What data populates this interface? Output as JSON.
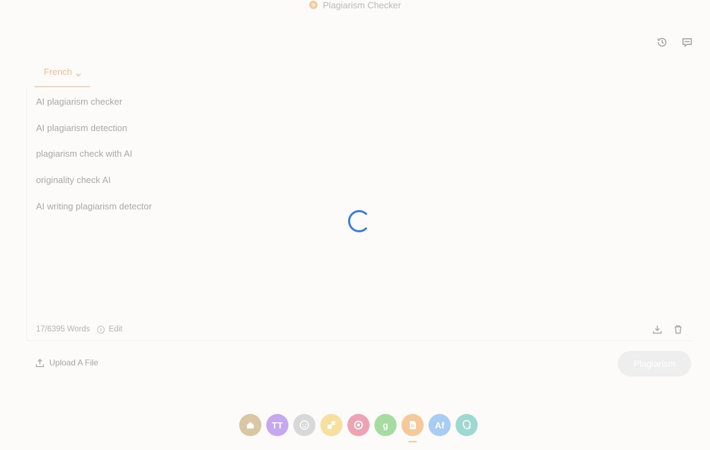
{
  "header": {
    "title": "Plagiarism Checker"
  },
  "top_actions": [
    {
      "name": "history-icon"
    },
    {
      "name": "feedback-chat-icon"
    }
  ],
  "language_tab": {
    "label": "French"
  },
  "keywords": [
    "AI plagiarism checker",
    "AI plagiarism detection",
    "plagiarism check with AI",
    "originality check AI",
    "AI writing plagiarism detector"
  ],
  "editor_footer": {
    "word_count": "17/6395 Words",
    "edit_label": "Edit"
  },
  "upload": {
    "label": "Upload A File"
  },
  "primary_button": {
    "label": "Plagiarism"
  },
  "tools": [
    {
      "name": "tool-home",
      "icon": "house-icon",
      "color": "#d8c7a2"
    },
    {
      "name": "tool-text-size",
      "icon": "tt-icon",
      "color": "#c6a8ef",
      "glyph": "TT"
    },
    {
      "name": "tool-humanize",
      "icon": "smiley-icon",
      "color": "#d8d8d8"
    },
    {
      "name": "tool-shapes",
      "icon": "shapes-icon",
      "color": "#f6e0a0"
    },
    {
      "name": "tool-rewrite",
      "icon": "rewrite-icon",
      "color": "#eda3b4"
    },
    {
      "name": "tool-grammar",
      "icon": "grammar-icon",
      "color": "#a6dca2",
      "glyph": "g"
    },
    {
      "name": "tool-plagiarism",
      "icon": "document-icon",
      "color": "#f6c99a",
      "active": true
    },
    {
      "name": "tool-ai-detect",
      "icon": "ai-icon",
      "color": "#a9cdf2",
      "glyph": "Af"
    },
    {
      "name": "tool-ai-head",
      "icon": "head-icon",
      "color": "#9fd8d1"
    }
  ]
}
